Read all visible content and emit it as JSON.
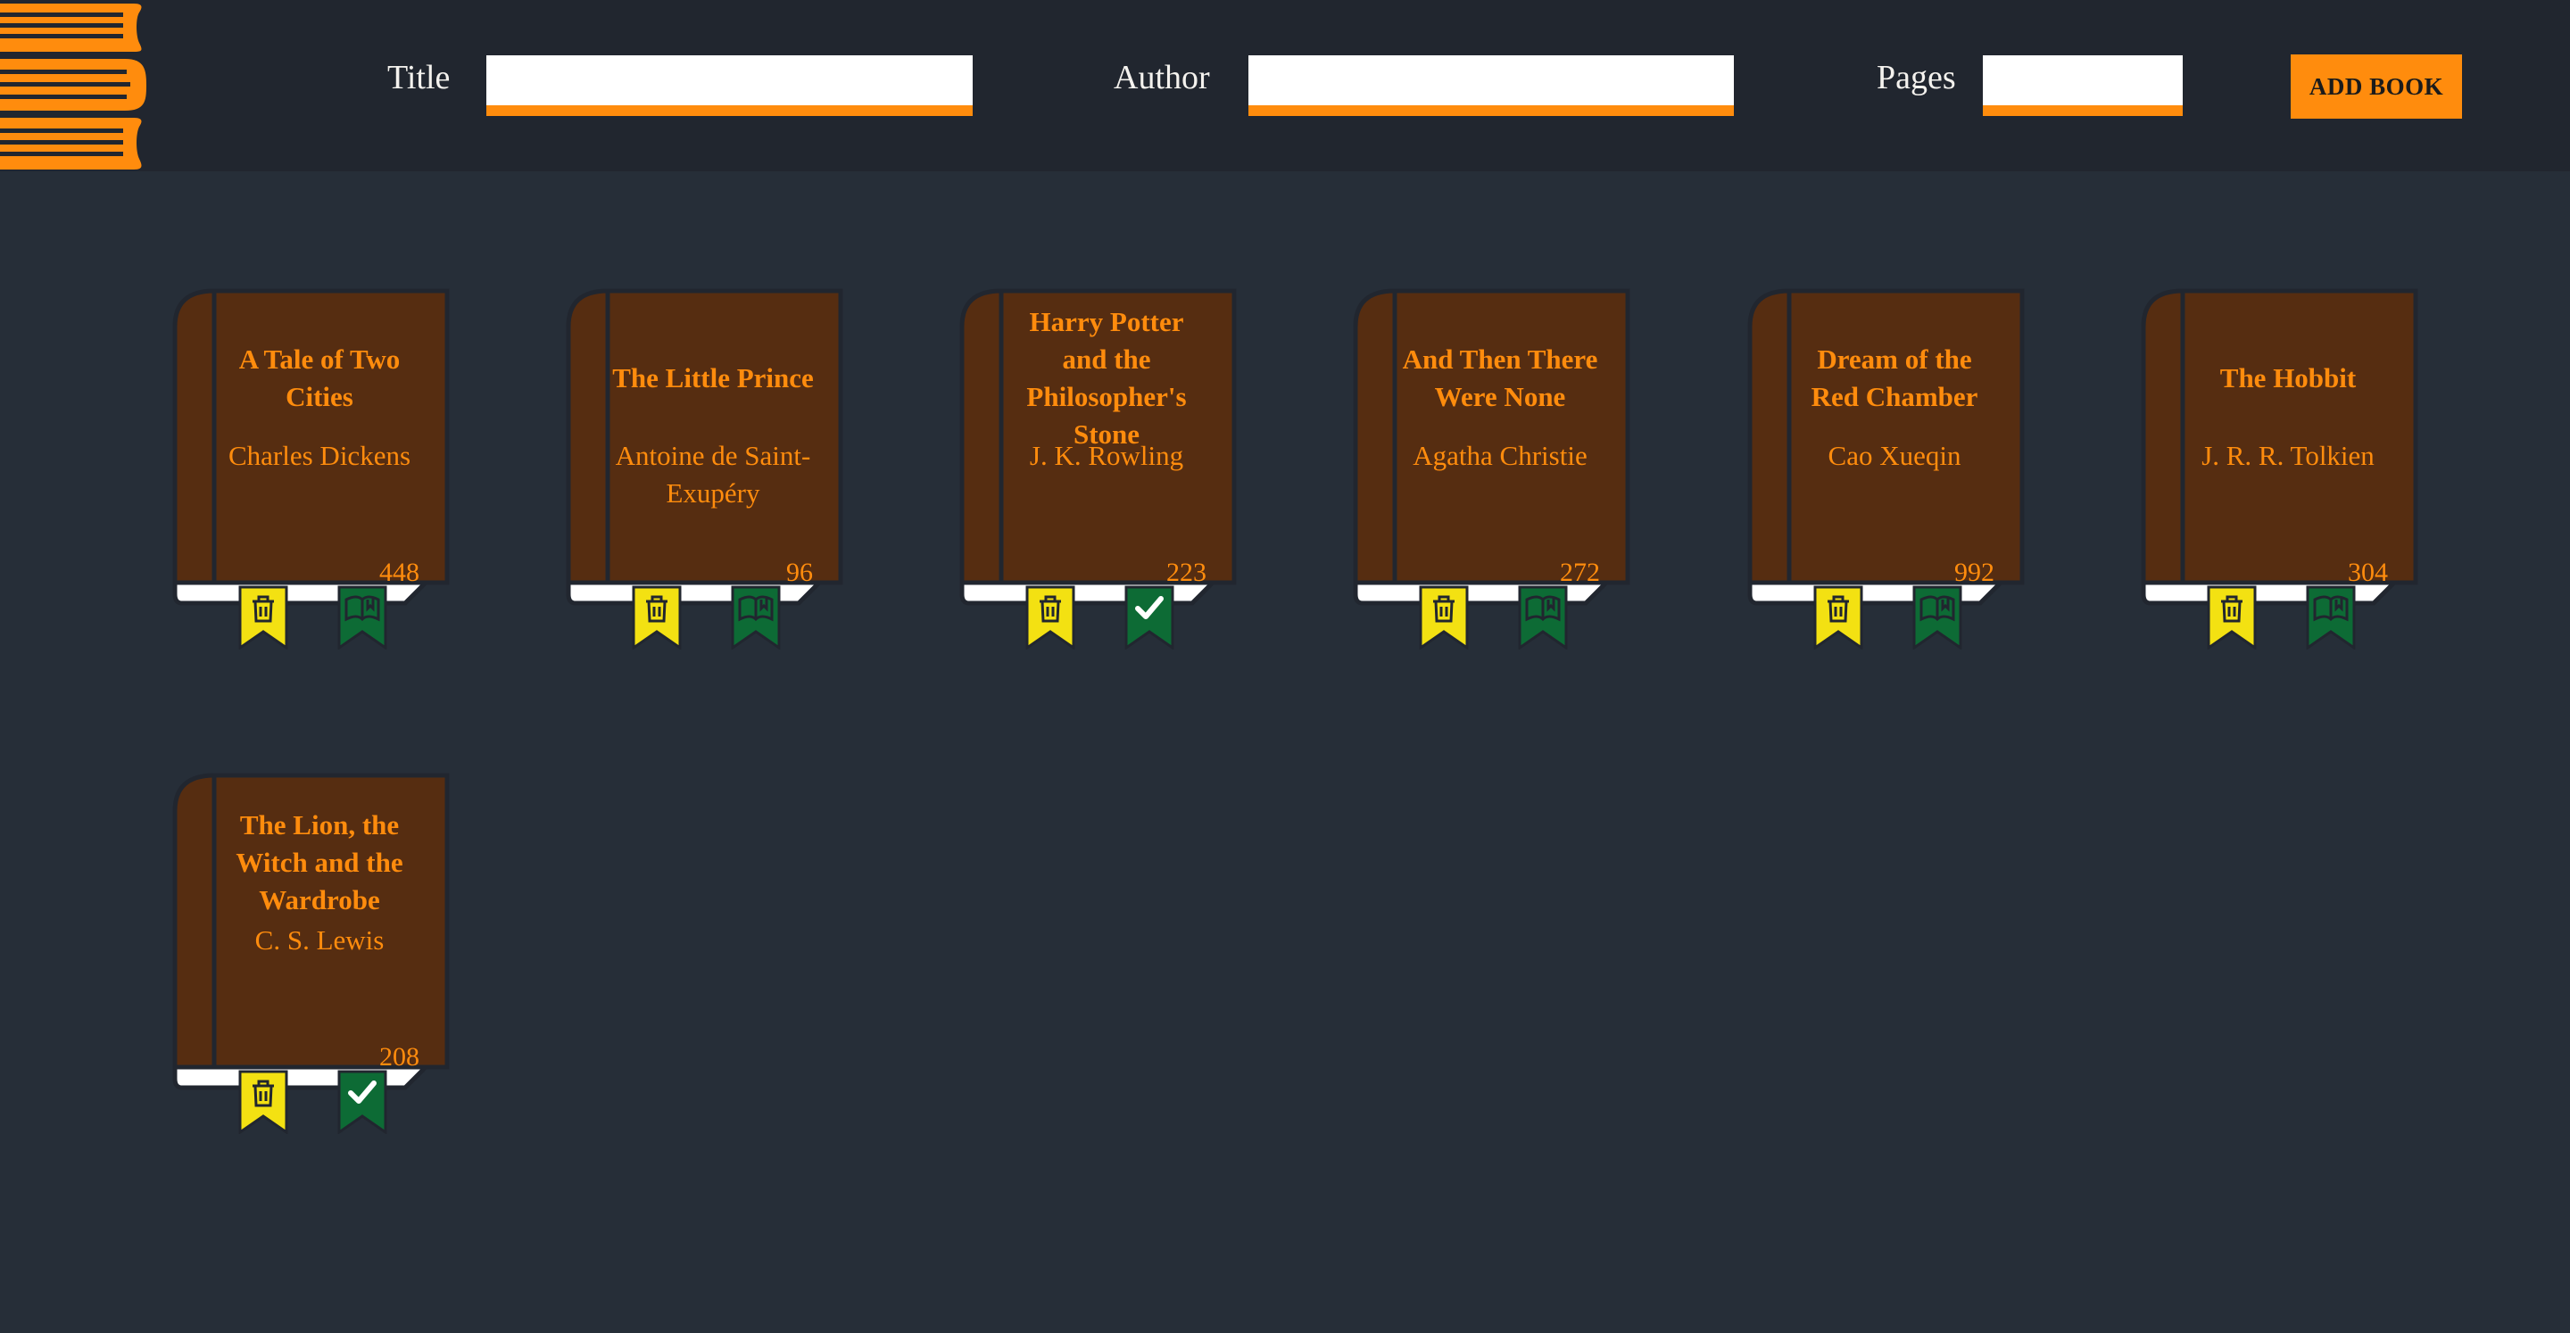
{
  "form": {
    "title_label": "Title",
    "title_value": "",
    "author_label": "Author",
    "author_value": "",
    "pages_label": "Pages",
    "pages_value": "",
    "add_button_label": "ADD BOOK"
  },
  "colors": {
    "accent": "#ff8c0d",
    "header_bg": "#21262f",
    "page_bg": "#262e38",
    "book_cover": "#562d11",
    "delete_ribbon": "#f3e112",
    "read_ribbon": "#0d6b35"
  },
  "books": [
    {
      "title": "A Tale of Two Cities",
      "author": "Charles Dickens",
      "pages": "448",
      "read": false,
      "delete_icon": "trash-icon",
      "read_icon": "open-book-icon"
    },
    {
      "title": "The Little Prince",
      "author": "Antoine de Saint-Exupéry",
      "pages": "96",
      "read": false,
      "delete_icon": "trash-icon",
      "read_icon": "open-book-icon"
    },
    {
      "title": "Harry Potter and the Philosopher's Stone",
      "author": "J. K. Rowling",
      "pages": "223",
      "read": true,
      "delete_icon": "trash-icon",
      "read_icon": "checkmark-icon"
    },
    {
      "title": "And Then There Were None",
      "author": "Agatha Christie",
      "pages": "272",
      "read": false,
      "delete_icon": "trash-icon",
      "read_icon": "open-book-icon"
    },
    {
      "title": "Dream of the Red Chamber",
      "author": "Cao Xueqin",
      "pages": "992",
      "read": false,
      "delete_icon": "trash-icon",
      "read_icon": "open-book-icon"
    },
    {
      "title": "The Hobbit",
      "author": "J. R. R. Tolkien",
      "pages": "304",
      "read": false,
      "delete_icon": "trash-icon",
      "read_icon": "open-book-icon"
    },
    {
      "title": "The Lion, the Witch and the Wardrobe",
      "author": "C. S. Lewis",
      "pages": "208",
      "read": true,
      "delete_icon": "trash-icon",
      "read_icon": "checkmark-icon"
    }
  ]
}
